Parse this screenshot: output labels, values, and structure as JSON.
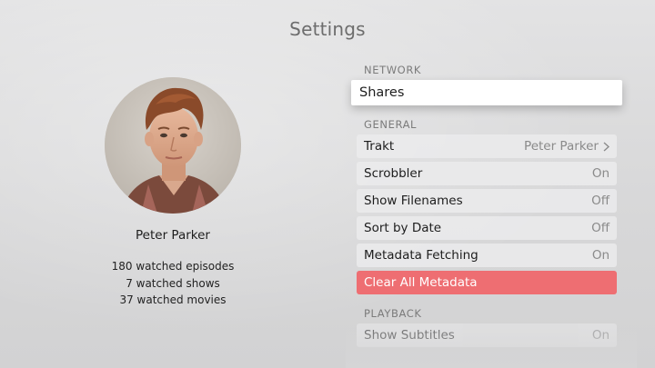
{
  "page": {
    "title": "Settings"
  },
  "profile": {
    "name": "Peter Parker",
    "stats": [
      "180 watched episodes",
      "7 watched shows",
      "37 watched movies"
    ]
  },
  "sections": {
    "network": {
      "header": "NETWORK",
      "shares_label": "Shares"
    },
    "general": {
      "header": "GENERAL",
      "rows": [
        {
          "label": "Trakt",
          "value": "Peter Parker",
          "icon": "chevron-right-icon"
        },
        {
          "label": "Scrobbler",
          "value": "On"
        },
        {
          "label": "Show Filenames",
          "value": "Off"
        },
        {
          "label": "Sort by Date",
          "value": "Off"
        },
        {
          "label": "Metadata Fetching",
          "value": "On"
        }
      ],
      "clear_label": "Clear All Metadata"
    },
    "playback": {
      "header": "PLAYBACK",
      "rows": [
        {
          "label": "Show Subtitles",
          "value": "On"
        }
      ]
    }
  },
  "colors": {
    "danger": "#ee6e72",
    "focused": "#ffffff"
  }
}
